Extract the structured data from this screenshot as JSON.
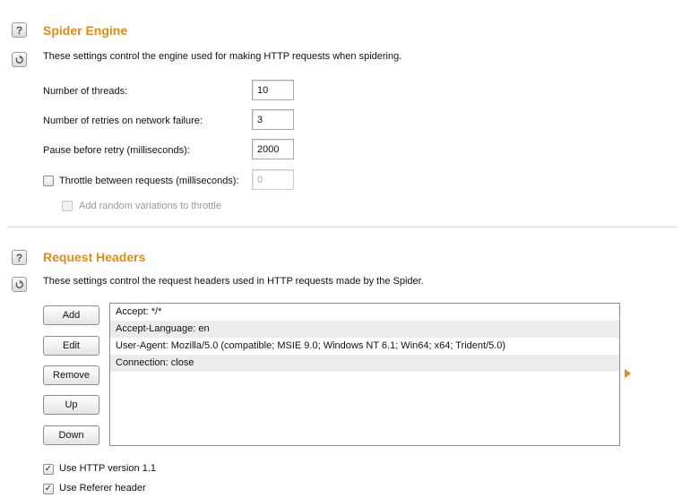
{
  "spider_engine": {
    "title": "Spider Engine",
    "description": "These settings control the engine used for making HTTP requests when spidering.",
    "threads_label": "Number of threads:",
    "threads_value": "10",
    "retries_label": "Number of retries on network failure:",
    "retries_value": "3",
    "pause_label": "Pause before retry (milliseconds):",
    "pause_value": "2000",
    "throttle_label": "Throttle between requests (milliseconds):",
    "throttle_value": "0",
    "throttle_checked": false,
    "random_label": "Add random variations to throttle",
    "random_checked": false
  },
  "request_headers": {
    "title": "Request Headers",
    "description": "These settings control the request headers used in HTTP requests made by the Spider.",
    "buttons": {
      "add": "Add",
      "edit": "Edit",
      "remove": "Remove",
      "up": "Up",
      "down": "Down"
    },
    "headers": [
      "Accept: */*",
      "Accept-Language: en",
      "User-Agent: Mozilla/5.0 (compatible; MSIE 9.0; Windows NT 6.1; Win64; x64; Trident/5.0)",
      "Connection: close"
    ],
    "http11_label": "Use HTTP version 1.1",
    "http11_checked": true,
    "referer_label": "Use Referer header",
    "referer_checked": true
  },
  "colors": {
    "accent": "#e58a12"
  },
  "icons": {
    "help": "help-icon",
    "restore": "restore-defaults-icon",
    "expand": "expand-arrow-icon"
  }
}
